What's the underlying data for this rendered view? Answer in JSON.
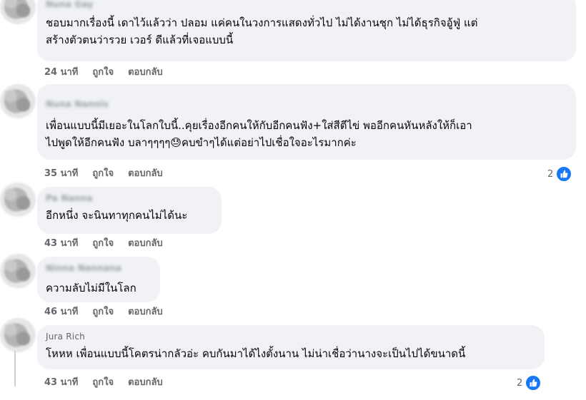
{
  "comments": [
    {
      "author": "Nuna Gay",
      "text": "ชอบมากเรื่องนี้ เดาไว้แล้วว่า ปลอม แค่คนในวงการแสดงทั่วไป ไม่ได้งานชุก ไม่ได้ธุรกิจอู้ฟู่ แต่\nสร้างตัวตนว่ารวย เวอร์ ดีแล้วที่เจอแบบนี้",
      "time": "24 นาที",
      "like": "ถูกใจ",
      "reply": "ตอบกลับ",
      "reactions": ""
    },
    {
      "author": "Nuna Nannis",
      "text": "เพื่อนแบบนี้มีเยอะในโลกใบนี้..คุยเรื่องอีกคนให้กับอีกคนฟัง+ใส่สีตีไข่ พออีกคนหันหลังให้ก็เอา\nไปพูดให้อีกคนฟัง บลาๆๆๆๆ😓คบขำๆได้แต่อย่าไปเชื่อใจอะไรมากค่ะ",
      "time": "35 นาที",
      "like": "ถูกใจ",
      "reply": "ตอบกลับ",
      "reactions": "2"
    },
    {
      "author": "Pa Nanna",
      "text": "อีกหนึ่ง จะนินทาทุกคนไม่ได้นะ",
      "time": "43 นาที",
      "like": "ถูกใจ",
      "reply": "ตอบกลับ",
      "reactions": ""
    },
    {
      "author": "Ninna Nannana",
      "text": "ความลับไม่มีในโลก",
      "time": "46 นาที",
      "like": "ถูกใจ",
      "reply": "ตอบกลับ",
      "reactions": ""
    },
    {
      "author": "Jura Rich",
      "text": "โหหห เพื่อนแบบนี้โคตรน่ากลัวอ่ะ คบกันมาได้ไงตั้งนาน ไม่น่าเชื่อว่านางจะเป็นไปได้ขนาดนี้",
      "time": "43 นาที",
      "like": "ถูกใจ",
      "reply": "ตอบกลับ",
      "reactions": "2"
    }
  ],
  "colors": {
    "bubble": "#f0f2f5",
    "meta": "#65676b",
    "like_badge": "#1877f2"
  },
  "icons": {
    "reaction": "like-thumb-icon"
  }
}
